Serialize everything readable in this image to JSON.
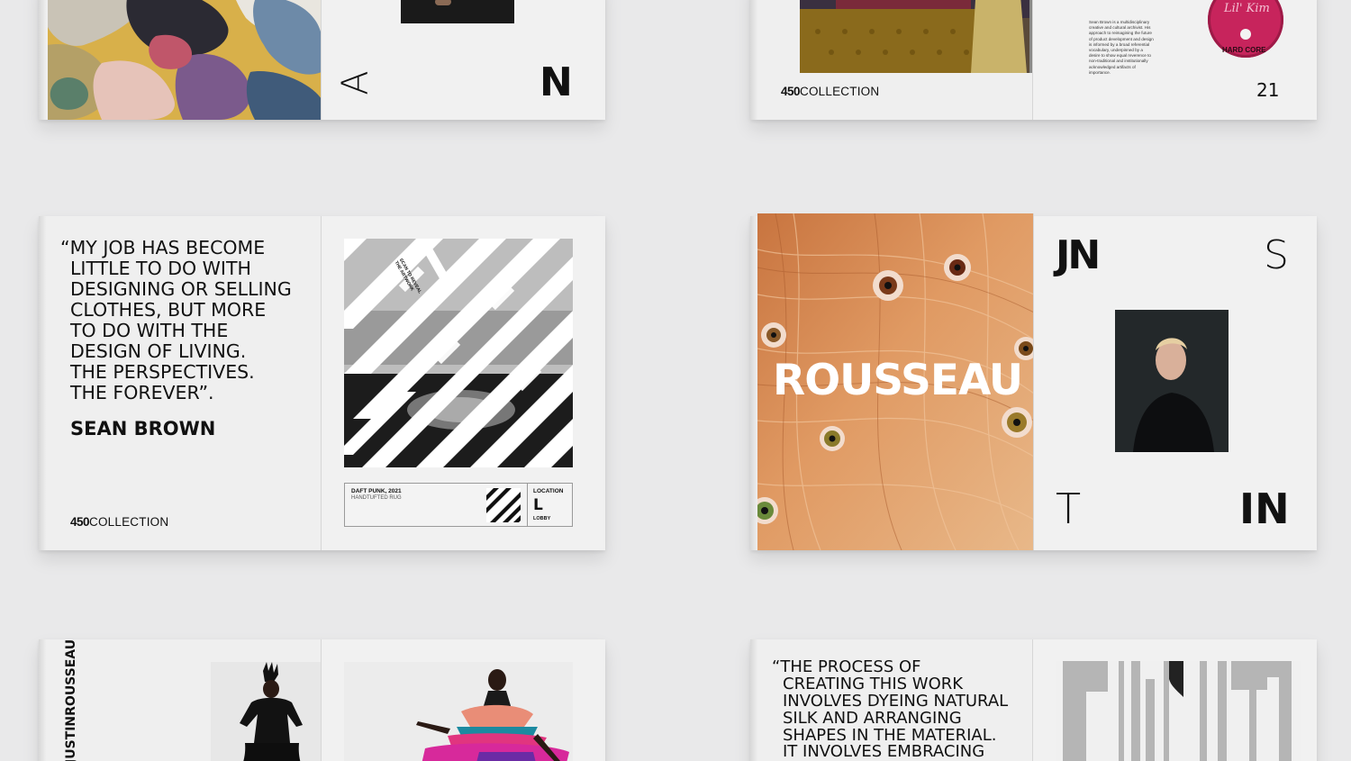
{
  "brand": {
    "logo_bold": "450",
    "logo_text": "COLLECTION"
  },
  "spreads": {
    "top_left": {
      "letters": {
        "left": "A",
        "right": "N"
      }
    },
    "top_right": {
      "bio": "Sean Brown is a multidisciplinary creative and cultural archivist. His approach to reimagining the future of product development and design is informed by a broad referential vocabulary, underpinned by a desire to show equal reverence to non-traditional and institutionally acknowledged artifacts of importance.",
      "page_number": "21",
      "cd_title": "Lil' Kim",
      "cd_subtitle": "HARD CORE"
    },
    "middle_left": {
      "quote_lines": [
        "“MY JOB HAS BECOME",
        "LITTLE TO DO WITH",
        "DESIGNING OR SELLING",
        "CLOTHES, BUT MORE",
        "TO DO WITH THE",
        "DESIGN OF LIVING.",
        "THE  PERSPECTIVES.",
        "THE FOREVER”."
      ],
      "author": "SEAN BROWN",
      "qr_caption": "SCAN TO REVEAL THE ARTWORK",
      "artwork_title": "DAFT PUNK, 2021",
      "artwork_medium": "HANDTUFTED RUG",
      "location_label": "LOCATION",
      "location_code": "L",
      "location_name": "LOBBY"
    },
    "middle_right": {
      "title": "ROUSSEAU",
      "letters": {
        "top_left": "JN",
        "top_right": "S",
        "bottom_left": "T",
        "bottom_right": "IN"
      }
    },
    "bottom_left": {
      "vertical_text": "JUSTINROUSSEAU"
    },
    "bottom_right": {
      "quote_lines": [
        "“THE PROCESS OF",
        "CREATING THIS WORK",
        "INVOLVES DYEING NATURAL",
        "SILK AND ARRANGING",
        "SHAPES IN THE MATERIAL.",
        "IT INVOLVES EMBRACING"
      ]
    }
  },
  "colors": {
    "background": "#e9e9ea",
    "page": "#efefef",
    "hair": "#d98a52",
    "cd_pink": "#c7245c"
  }
}
